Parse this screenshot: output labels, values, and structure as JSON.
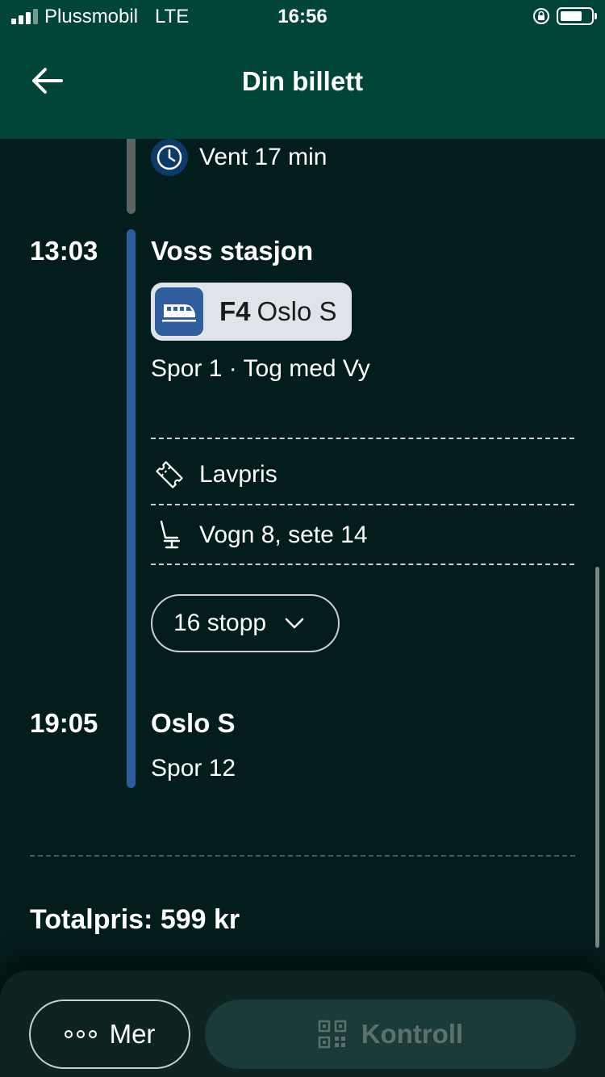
{
  "status_bar": {
    "carrier": "Plussmobil",
    "network": "LTE",
    "time": "16:56"
  },
  "header": {
    "title": "Din billett",
    "back_icon": "arrow-left-icon"
  },
  "wait": {
    "icon": "clock-icon",
    "text": "Vent 17 min"
  },
  "departure": {
    "time": "13:03",
    "station": "Voss stasjon",
    "line": {
      "icon": "train-icon",
      "code": "F4",
      "destination": "Oslo S"
    },
    "platform_info": "Spor 1 · Tog med Vy"
  },
  "ticket": {
    "fare": {
      "icon": "ticket-icon",
      "label": "Lavpris"
    },
    "seat": {
      "icon": "seat-icon",
      "label": "Vogn 8, sete 14"
    }
  },
  "stops_button": {
    "label": "16 stopp",
    "icon": "chevron-down-icon"
  },
  "arrival": {
    "time": "19:05",
    "station": "Oslo S",
    "platform_info": "Spor 12"
  },
  "total": {
    "label": "Totalpris: 599 kr"
  },
  "bottom_bar": {
    "more_label": "Mer",
    "more_icon": "more-dots-icon",
    "control_label": "Kontroll",
    "control_icon": "qr-code-icon"
  },
  "colors": {
    "header_bg": "#004538",
    "page_bg": "#031d1c",
    "rail_blue": "#2b5c9e",
    "train_blue": "#2f5d9d",
    "chip_bg": "#dfe4ea"
  }
}
